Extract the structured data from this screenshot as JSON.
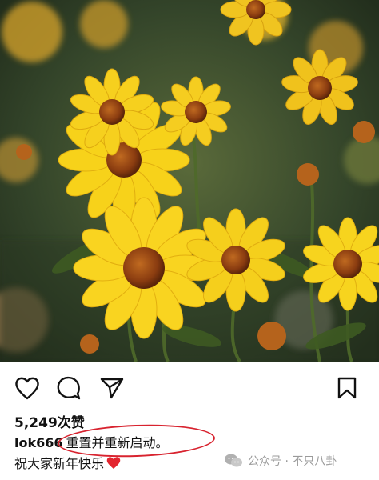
{
  "post": {
    "likes_text": "5,249次赞",
    "username": "lok666",
    "caption": "重置并重新启动。",
    "second_line": "祝大家新年快乐"
  },
  "actions": {
    "like_icon": "heart-outline-icon",
    "comment_icon": "speech-bubble-icon",
    "share_icon": "paper-plane-icon",
    "save_icon": "bookmark-icon"
  },
  "emoji": "red-heart-emoji",
  "watermark": {
    "logo_icon": "wechat-logo",
    "text": "公众号 · 不只八卦"
  },
  "colors": {
    "annotation": "#d8232f",
    "watermark": "#9a9a9a",
    "text": "#111111"
  }
}
